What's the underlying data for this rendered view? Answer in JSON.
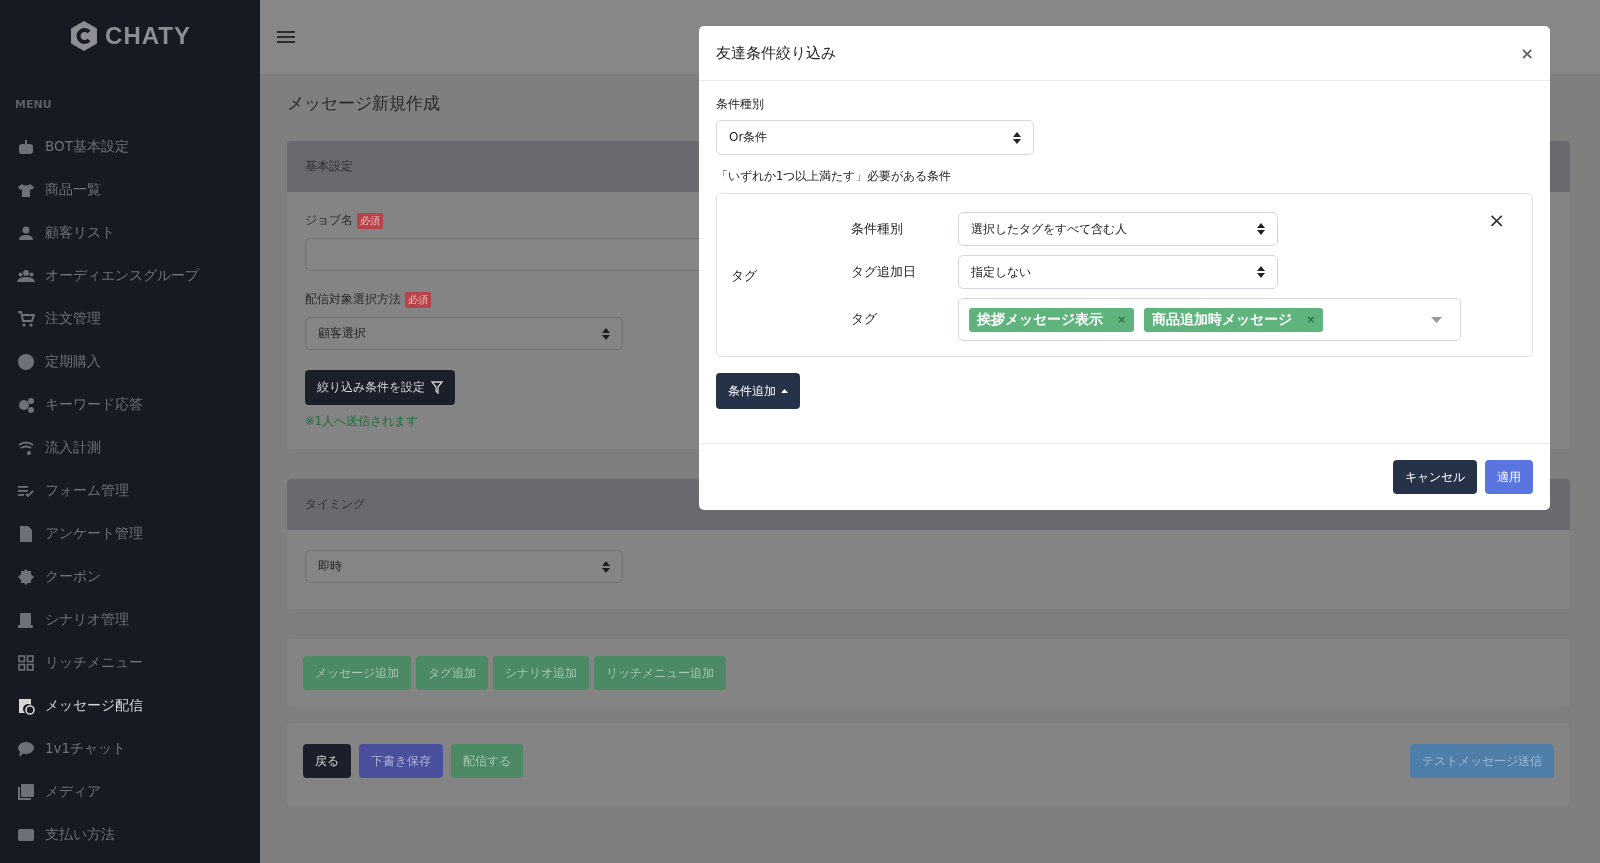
{
  "sidebar": {
    "logo": "CHATY",
    "section_label": "MENU",
    "items": [
      {
        "label": "BOT基本設定",
        "selected": false
      },
      {
        "label": "商品一覧",
        "selected": false
      },
      {
        "label": "顧客リスト",
        "selected": false
      },
      {
        "label": "オーディエンスグループ",
        "selected": false
      },
      {
        "label": "注文管理",
        "selected": false
      },
      {
        "label": "定期購入",
        "selected": false
      },
      {
        "label": "キーワード応答",
        "selected": false
      },
      {
        "label": "流入計測",
        "selected": false
      },
      {
        "label": "フォーム管理",
        "selected": false
      },
      {
        "label": "アンケート管理",
        "selected": false
      },
      {
        "label": "クーポン",
        "selected": false
      },
      {
        "label": "シナリオ管理",
        "selected": false
      },
      {
        "label": "リッチメニュー",
        "selected": false
      },
      {
        "label": "メッセージ配信",
        "selected": true
      },
      {
        "label": "1v1チャット",
        "selected": false
      },
      {
        "label": "メディア",
        "selected": false
      },
      {
        "label": "支払い方法",
        "selected": false
      }
    ]
  },
  "page": {
    "title": "メッセージ新規作成",
    "basic_card": {
      "header": "基本設定",
      "job_name_label": "ジョブ名",
      "job_name_badge": "必須",
      "method_label": "配信対象選択方法",
      "method_badge": "必須",
      "method_value": "顧客選択",
      "filter_button": "絞り込み条件を設定",
      "recipients_note": "※1人へ送信されます"
    },
    "timing_card": {
      "header": "タイミング",
      "value": "即時"
    },
    "add_buttons": [
      "メッセージ追加",
      "タグ追加",
      "シナリオ追加",
      "リッチメニュー追加"
    ],
    "footer_buttons": [
      {
        "label": "戻る",
        "kind": "dark"
      },
      {
        "label": "下書き保存",
        "kind": "indigo"
      },
      {
        "label": "配信する",
        "kind": "green"
      }
    ],
    "test_button": "テストメッセージ送信"
  },
  "modal": {
    "title": "友達条件絞り込み",
    "close": "×",
    "condition_type_label": "条件種別",
    "condition_type_value": "Or条件",
    "description": "「いずれか1つ以上満たす」必要がある条件",
    "conditions": [
      {
        "category": "タグ",
        "remove": "×",
        "rows": [
          {
            "label": "条件種別",
            "kind": "select",
            "value": "選択したタグをすべて含む人"
          },
          {
            "label": "タグ追加日",
            "kind": "select",
            "value": "指定しない"
          },
          {
            "label": "タグ",
            "kind": "tags",
            "tags": [
              {
                "label": "挨拶メッセージ表示",
                "remove": "×"
              },
              {
                "label": "商品追加時メッセージ",
                "remove": "×"
              }
            ]
          }
        ]
      }
    ],
    "add_condition_button": "条件追加",
    "cancel_button": "キャンセル",
    "apply_button": "適用"
  }
}
